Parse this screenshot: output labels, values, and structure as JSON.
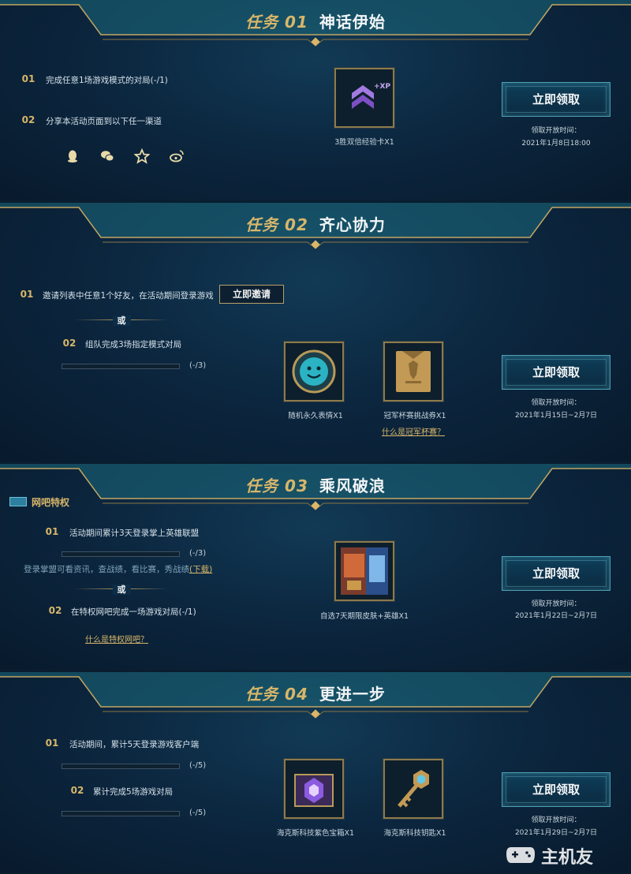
{
  "tasks": [
    {
      "num": "任务 01",
      "name": "神话伊始",
      "steps": [
        {
          "index": "01",
          "text": "完成任意1场游戏模式的对局(-/1)"
        },
        {
          "index": "02",
          "text": "分享本活动页面到以下任一渠道"
        }
      ],
      "share_icons": [
        "qq-icon",
        "wechat-icon",
        "star-icon",
        "weibo-icon"
      ],
      "rewards": [
        {
          "icon": "xp-rank-card-icon",
          "label": "3胜双倍经验卡X1",
          "tag": "+XP"
        }
      ],
      "claim_label": "立即领取",
      "time_label": "领取开放时间：",
      "time_value": "2021年1月8日18:00"
    },
    {
      "num": "任务 02",
      "name": "齐心协力",
      "steps": [
        {
          "index": "01",
          "text": "邀请列表中任意1个好友，在活动期间登录游戏"
        },
        {
          "index": "02",
          "text": "组队完成3场指定模式对局",
          "progress": 0,
          "count": "(-/3)"
        }
      ],
      "invite_label": "立即邀请",
      "or_label": "或",
      "rewards": [
        {
          "icon": "smiley-emote-icon",
          "label": "随机永久表情X1"
        },
        {
          "icon": "champion-cup-ticket-icon",
          "label": "冠军杯赛挑战券X1"
        }
      ],
      "help_link": "什么是冠军杯赛？",
      "claim_label": "立即领取",
      "time_label": "领取开放时间：",
      "time_value": "2021年1月15日~2月7日"
    },
    {
      "num": "任务 03",
      "name": "乘风破浪",
      "logo_text": "网吧特权",
      "steps": [
        {
          "index": "01",
          "text": "活动期间累计3天登录掌上英雄联盟",
          "progress": 0,
          "count": "(-/3)"
        },
        {
          "index": "02",
          "text": "在特权网吧完成一场游戏对局(-/1)"
        }
      ],
      "app_note": "登录掌盟可看资讯，查战绩，看比赛，秀战绩",
      "download_label": "(下载)",
      "or_label": "或",
      "help_link": "什么是特权网吧？",
      "rewards": [
        {
          "icon": "skin-hero-card-icon",
          "label": "自选7天期限皮肤+英雄X1"
        }
      ],
      "claim_label": "立即领取",
      "time_label": "领取开放时间：",
      "time_value": "2021年1月22日~2月7日"
    },
    {
      "num": "任务 04",
      "name": "更进一步",
      "steps": [
        {
          "index": "01",
          "text": "活动期间，累计5天登录游戏客户端",
          "progress": 0,
          "count": "(-/5)"
        },
        {
          "index": "02",
          "text": "累计完成5场游戏对局",
          "progress": 0,
          "count": "(-/5)"
        }
      ],
      "rewards": [
        {
          "icon": "hextech-purple-chest-icon",
          "label": "海克斯科技紫色宝箱X1"
        },
        {
          "icon": "hextech-key-icon",
          "label": "海克斯科技钥匙X1"
        }
      ],
      "claim_label": "立即领取",
      "time_label": "领取开放时间：",
      "time_value": "2021年1月29日~2月7日"
    }
  ],
  "watermark": "主机友",
  "colors": {
    "gold": "#d8b66a",
    "teal": "#4f9fb3",
    "bg": "#081a2c"
  }
}
